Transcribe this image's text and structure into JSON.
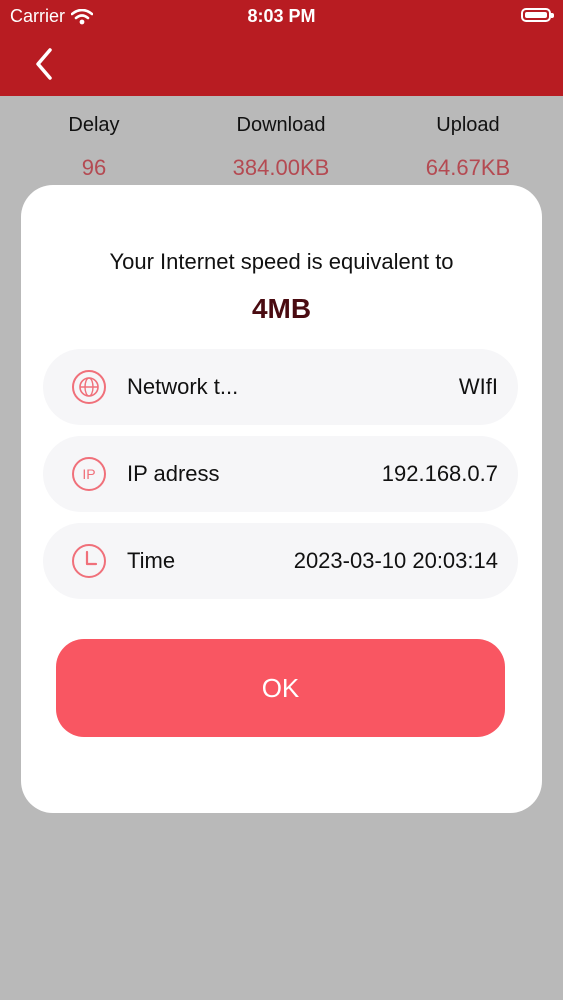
{
  "status_bar": {
    "carrier": "Carrier",
    "time": "8:03 PM"
  },
  "nav": {
    "back_icon": "chevron-left-icon"
  },
  "stats": [
    {
      "label": "Delay",
      "value": "96"
    },
    {
      "label": "Download",
      "value": "384.00KB"
    },
    {
      "label": "Upload",
      "value": "64.67KB"
    }
  ],
  "modal": {
    "headline": "Your Internet speed is equivalent to",
    "speed": "4MB",
    "rows": [
      {
        "icon": "globe-icon",
        "label": "Network t...",
        "value": "WIfI"
      },
      {
        "icon": "ip-icon",
        "label": "IP adress",
        "value": "192.168.0.7"
      },
      {
        "icon": "clock-icon",
        "label": "Time",
        "value": "2023-03-10 20:03:14"
      }
    ],
    "ok_label": "OK"
  },
  "colors": {
    "header_red": "#b81c22",
    "accent_red": "#f95662",
    "stat_value": "#b44a52",
    "speed_text": "#4a0b11",
    "overlay_gray": "#b9b9b9"
  }
}
